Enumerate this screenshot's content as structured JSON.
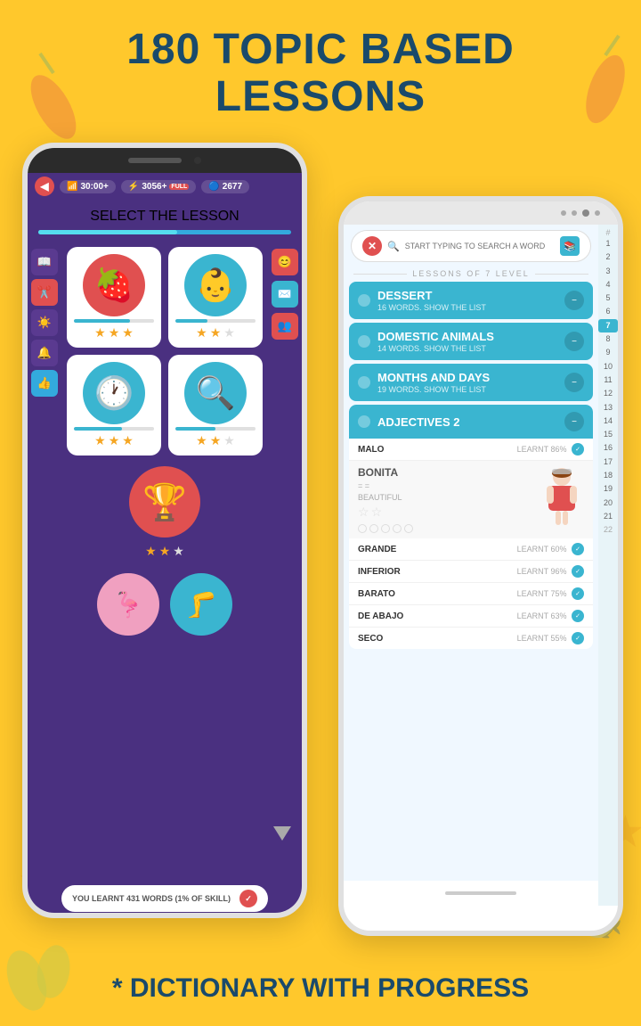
{
  "page": {
    "background_color": "#FFC82C",
    "title": "180 TOPIC BASED\nLESSONS",
    "bottom_text": "* DICTIONARY WITH PROGRESS"
  },
  "phone_left": {
    "status": {
      "time": "30:00+",
      "xp": "3056+",
      "xp_label": "FULL",
      "coins": "2677"
    },
    "lesson_header": "SELECT THE LESSON",
    "lessons": [
      {
        "icon": "🍓",
        "color": "red",
        "stars": 3,
        "progress": 70
      },
      {
        "icon": "👶",
        "color": "blue",
        "stars": 2,
        "progress": 40
      },
      {
        "icon": "🕐",
        "color": "blue",
        "stars": 3,
        "progress": 60
      },
      {
        "icon": "🔍",
        "color": "blue",
        "stars": 2,
        "progress": 50
      },
      {
        "icon": "🏆",
        "color": "red",
        "stars": 2,
        "progress": 0
      }
    ],
    "bottom_items": [
      {
        "icon": "🦩",
        "color": "pink"
      },
      {
        "icon": "🦵",
        "color": "blue"
      }
    ],
    "learnt_text": "YOU LEARNT 431 WORDS (1% OF SKILL)"
  },
  "phone_right": {
    "search_placeholder": "START TYPING TO SEARCH A WORD",
    "level_label": "LESSONS OF 7 LEVEL",
    "lessons": [
      {
        "title": "DESSERT",
        "words": "16 WORDS. SHOW THE LIST"
      },
      {
        "title": "DOMESTIC ANIMALS",
        "words": "14 WORDS. SHOW THE LIST"
      },
      {
        "title": "MONTHS AND DAYS",
        "words": "19 WORDS. SHOW THE LIST"
      },
      {
        "title": "ADJECTIVES 2",
        "words": ""
      }
    ],
    "words": [
      {
        "word": "MALO",
        "learnt": "LEARNT 86%"
      },
      {
        "word": "BONITA",
        "translation": "= =",
        "meaning": "BEAUTIFUL",
        "expanded": true
      },
      {
        "word": "GRANDE",
        "learnt": "LEARNT 60%"
      },
      {
        "word": "INFERIOR",
        "learnt": "LEARNT 96%"
      },
      {
        "word": "BARATO",
        "learnt": "LEARNT 75%"
      },
      {
        "word": "DE ABAJO",
        "learnt": "LEARNT 63%"
      },
      {
        "word": "SECO",
        "learnt": "LEARNT 55%"
      }
    ],
    "numbers": [
      "#",
      "1",
      "2",
      "3",
      "4",
      "5",
      "6",
      "7",
      "8",
      "9",
      "10",
      "11",
      "12",
      "13",
      "14",
      "15",
      "16",
      "17",
      "18",
      "19",
      "20",
      "21",
      "22"
    ]
  }
}
